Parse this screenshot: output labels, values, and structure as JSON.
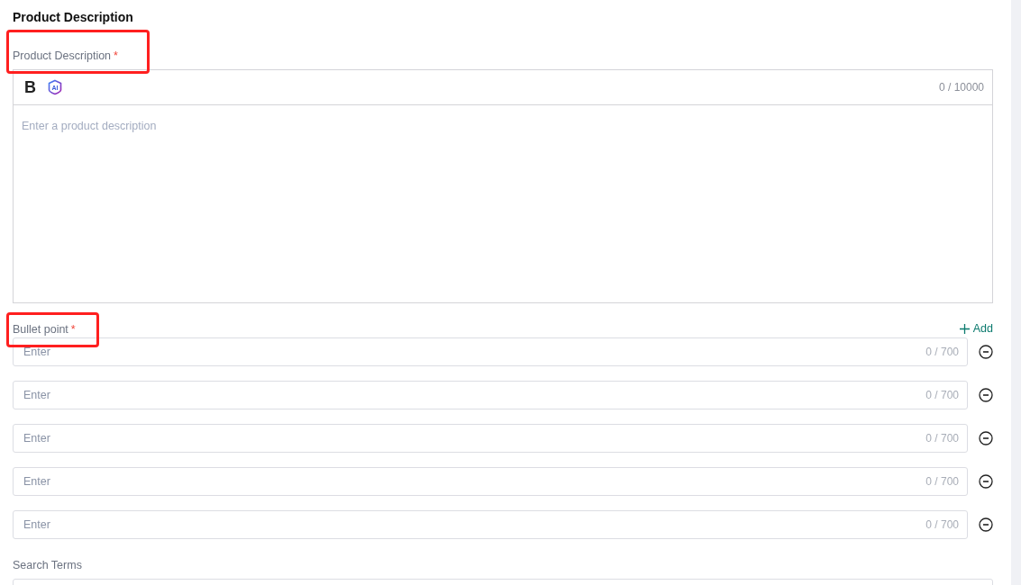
{
  "section_title": "Product Description",
  "description": {
    "label": "Product Description",
    "required_mark": "*",
    "highlighted": true,
    "toolbar": {
      "bold": "B",
      "ai": "AI"
    },
    "counter": "0 / 10000",
    "placeholder": "Enter a product description"
  },
  "bullets": {
    "label": "Bullet point",
    "required_mark": "*",
    "highlighted": true,
    "add": "Add",
    "items": [
      {
        "placeholder": "Enter",
        "counter": "0 / 700"
      },
      {
        "placeholder": "Enter",
        "counter": "0 / 700"
      },
      {
        "placeholder": "Enter",
        "counter": "0 / 700"
      },
      {
        "placeholder": "Enter",
        "counter": "0 / 700"
      },
      {
        "placeholder": "Enter",
        "counter": "0 / 700"
      }
    ]
  },
  "search_terms": {
    "label": "Search Terms"
  }
}
